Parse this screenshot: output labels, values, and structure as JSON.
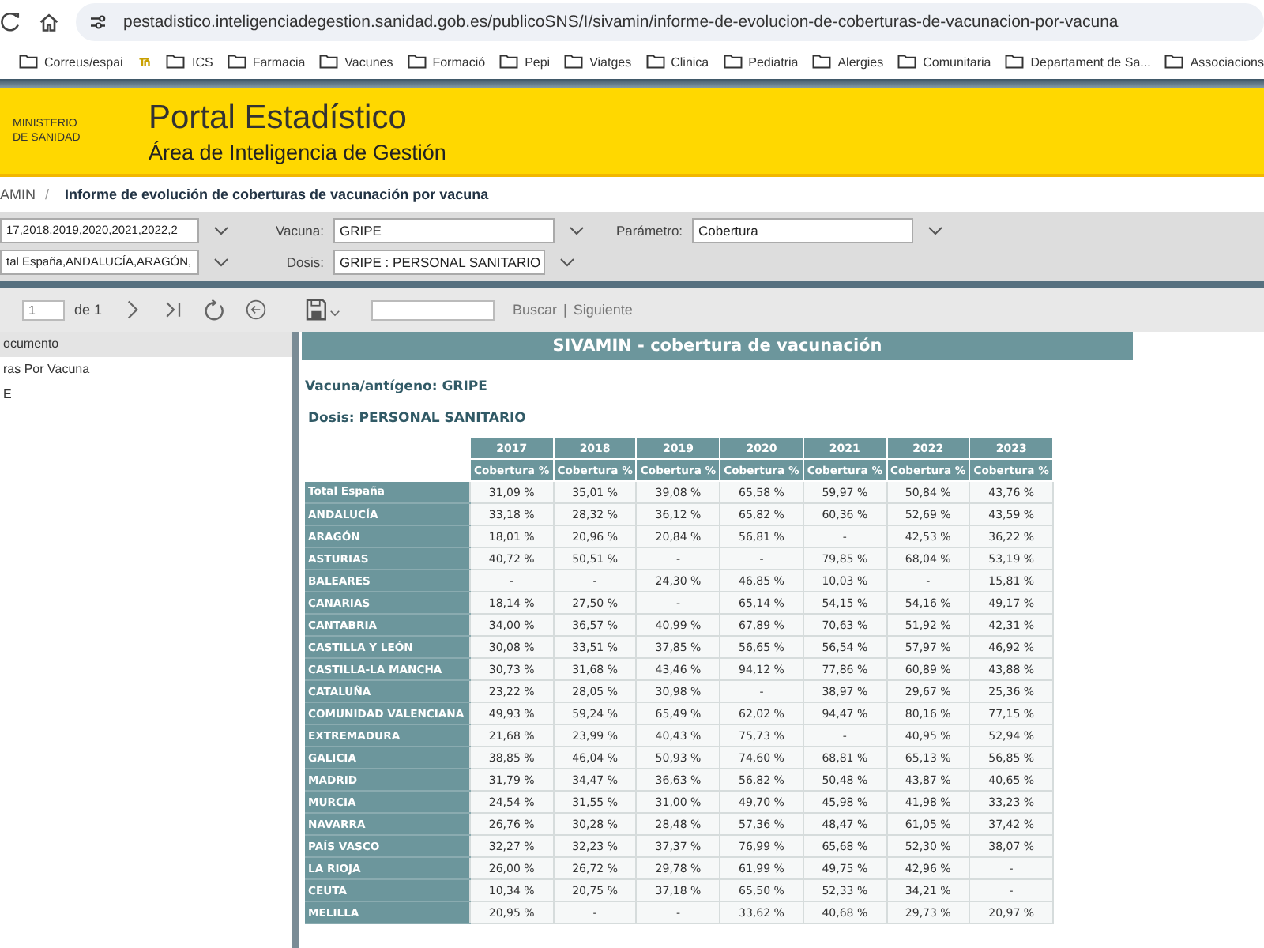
{
  "browser": {
    "url": "pestadistico.inteligenciadegestion.sanidad.gob.es/publicoSNS/I/sivamin/informe-de-evolucion-de-coberturas-de-vacunacion-por-vacuna",
    "bookmarks": [
      {
        "label": "Correus/espai",
        "kind": "folder"
      },
      {
        "kind": "logo"
      },
      {
        "label": "ICS",
        "kind": "folder"
      },
      {
        "label": "Farmacia",
        "kind": "folder"
      },
      {
        "label": "Vacunes",
        "kind": "folder"
      },
      {
        "label": "Formació",
        "kind": "folder"
      },
      {
        "label": "Pepi",
        "kind": "folder"
      },
      {
        "label": "Viatges",
        "kind": "folder"
      },
      {
        "label": "Clinica",
        "kind": "folder"
      },
      {
        "label": "Pediatria",
        "kind": "folder"
      },
      {
        "label": "Alergies",
        "kind": "folder"
      },
      {
        "label": "Comunitaria",
        "kind": "folder"
      },
      {
        "label": "Departament de Sa...",
        "kind": "folder"
      },
      {
        "label": "Associacions",
        "kind": "folder"
      }
    ]
  },
  "header": {
    "ministry": "MINISTERIO DE SANIDAD",
    "title": "Portal Estadístico",
    "subtitle": "Área de Inteligencia de Gestión"
  },
  "breadcrumb": {
    "parent": "AMIN",
    "separator": "/",
    "current": "Informe de evolución de coberturas de vacunación por vacuna"
  },
  "filters": {
    "years": "17,2018,2019,2020,2021,2022,2",
    "regions": "tal España,ANDALUCÍA,ARAGÓN,",
    "vacuna_label": "Vacuna:",
    "vacuna": "GRIPE",
    "dosis_label": "Dosis:",
    "dosis": "GRIPE : PERSONAL SANITARIO",
    "parametro_label": "Parámetro:",
    "parametro": "Cobertura"
  },
  "toolbar": {
    "page": "1",
    "of": "de 1",
    "search_button": "Buscar",
    "divider": "|",
    "next_link": "Siguiente"
  },
  "sidebar": {
    "header": "ocumento",
    "items": [
      {
        "label": "ras Por Vacuna"
      },
      {
        "label": "E"
      }
    ]
  },
  "report": {
    "title": "SIVAMIN - cobertura de vacunación",
    "vacuna": "Vacuna/antígeno: GRIPE",
    "dosis": "Dosis: PERSONAL SANITARIO",
    "years": [
      "2017",
      "2018",
      "2019",
      "2020",
      "2021",
      "2022",
      "2023"
    ],
    "measures": [
      "Cobertura %",
      "Cobertura %",
      "Cobertura %",
      "Cobertura %",
      "Cobertura %",
      "Cobertura %",
      "Cobertura %"
    ],
    "rows": [
      {
        "name": "Total España",
        "values": [
          "31,09 %",
          "35,01 %",
          "39,08 %",
          "65,58 %",
          "59,97 %",
          "50,84 %",
          "43,76 %"
        ]
      },
      {
        "name": "ANDALUCÍA",
        "values": [
          "33,18 %",
          "28,32 %",
          "36,12 %",
          "65,82 %",
          "60,36 %",
          "52,69 %",
          "43,59 %"
        ]
      },
      {
        "name": "ARAGÓN",
        "values": [
          "18,01 %",
          "20,96 %",
          "20,84 %",
          "56,81 %",
          "-",
          "42,53 %",
          "36,22 %"
        ]
      },
      {
        "name": "ASTURIAS",
        "values": [
          "40,72 %",
          "50,51 %",
          "-",
          "-",
          "79,85 %",
          "68,04 %",
          "53,19 %"
        ]
      },
      {
        "name": "BALEARES",
        "values": [
          "-",
          "-",
          "24,30 %",
          "46,85 %",
          "10,03 %",
          "-",
          "15,81 %"
        ]
      },
      {
        "name": "CANARIAS",
        "values": [
          "18,14 %",
          "27,50 %",
          "-",
          "65,14 %",
          "54,15 %",
          "54,16 %",
          "49,17 %"
        ]
      },
      {
        "name": "CANTABRIA",
        "values": [
          "34,00 %",
          "36,57 %",
          "40,99 %",
          "67,89 %",
          "70,63 %",
          "51,92 %",
          "42,31 %"
        ]
      },
      {
        "name": "CASTILLA Y LEÓN",
        "values": [
          "30,08 %",
          "33,51 %",
          "37,85 %",
          "56,65 %",
          "56,54 %",
          "57,97 %",
          "46,92 %"
        ]
      },
      {
        "name": "CASTILLA-LA MANCHA",
        "values": [
          "30,73 %",
          "31,68 %",
          "43,46 %",
          "94,12 %",
          "77,86 %",
          "60,89 %",
          "43,88 %"
        ]
      },
      {
        "name": "CATALUÑA",
        "values": [
          "23,22 %",
          "28,05 %",
          "30,98 %",
          "-",
          "38,97 %",
          "29,67 %",
          "25,36 %"
        ]
      },
      {
        "name": "COMUNIDAD VALENCIANA",
        "values": [
          "49,93 %",
          "59,24 %",
          "65,49 %",
          "62,02 %",
          "94,47 %",
          "80,16 %",
          "77,15 %"
        ]
      },
      {
        "name": "EXTREMADURA",
        "values": [
          "21,68 %",
          "23,99 %",
          "40,43 %",
          "75,73 %",
          "-",
          "40,95 %",
          "52,94 %"
        ]
      },
      {
        "name": "GALICIA",
        "values": [
          "38,85 %",
          "46,04 %",
          "50,93 %",
          "74,60 %",
          "68,81 %",
          "65,13 %",
          "56,85 %"
        ]
      },
      {
        "name": "MADRID",
        "values": [
          "31,79 %",
          "34,47 %",
          "36,63 %",
          "56,82 %",
          "50,48 %",
          "43,87 %",
          "40,65 %"
        ]
      },
      {
        "name": "MURCIA",
        "values": [
          "24,54 %",
          "31,55 %",
          "31,00 %",
          "49,70 %",
          "45,98 %",
          "41,98 %",
          "33,23 %"
        ]
      },
      {
        "name": "NAVARRA",
        "values": [
          "26,76 %",
          "30,28 %",
          "28,48 %",
          "57,36 %",
          "48,47 %",
          "61,05 %",
          "37,42 %"
        ]
      },
      {
        "name": "PAÍS VASCO",
        "values": [
          "32,27 %",
          "32,23 %",
          "37,37 %",
          "76,99 %",
          "65,68 %",
          "52,30 %",
          "38,07 %"
        ]
      },
      {
        "name": "LA RIOJA",
        "values": [
          "26,00 %",
          "26,72 %",
          "29,78 %",
          "61,99 %",
          "49,75 %",
          "42,96 %",
          "-"
        ]
      },
      {
        "name": "CEUTA",
        "values": [
          "10,34 %",
          "20,75 %",
          "37,18 %",
          "65,50 %",
          "52,33 %",
          "34,21 %",
          "-"
        ]
      },
      {
        "name": "MELILLA",
        "values": [
          "20,95 %",
          "-",
          "-",
          "33,62 %",
          "40,68 %",
          "29,73 %",
          "20,97 %"
        ]
      }
    ]
  }
}
